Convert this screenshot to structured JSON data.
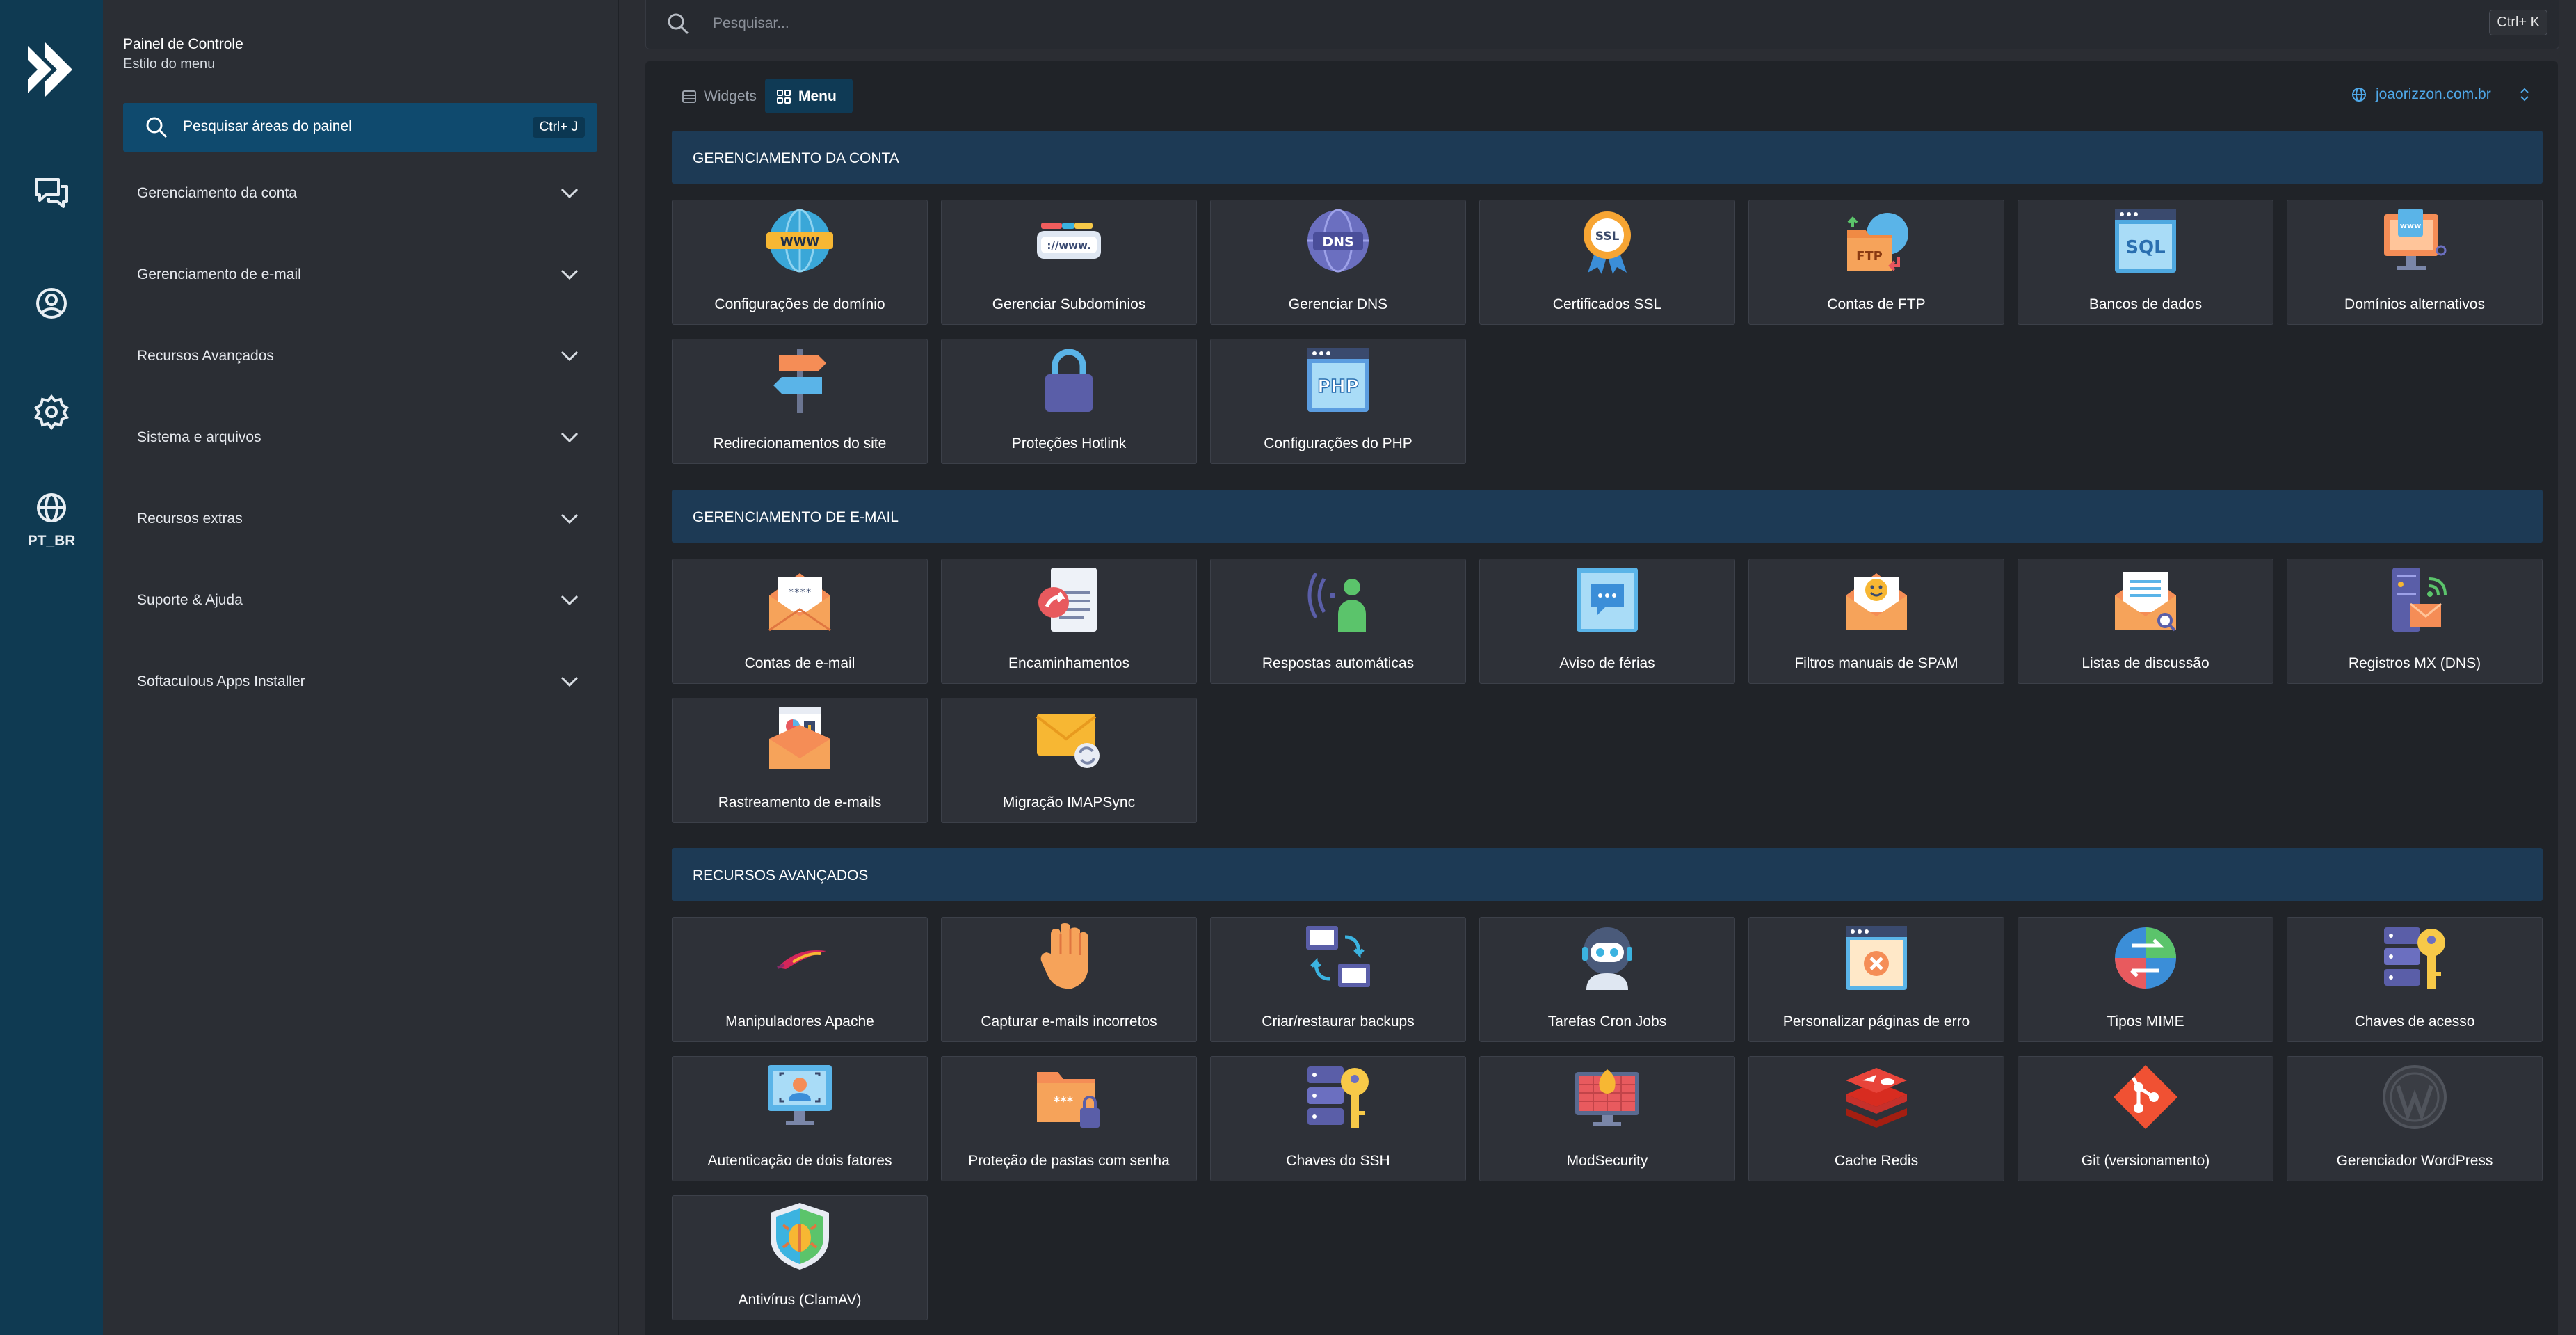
{
  "rail": {
    "logo_icon": "cwp-arrow-logo",
    "icons": [
      "chat-icon",
      "user-circle-icon",
      "gear-icon",
      "globe-icon"
    ],
    "language": "PT_BR"
  },
  "sidebar": {
    "title": "Painel de Controle",
    "subtitle": "Estilo do menu",
    "search_placeholder": "Pesquisar áreas do painel",
    "search_shortcut": "Ctrl+ J",
    "items": [
      {
        "label": "Gerenciamento da conta"
      },
      {
        "label": "Gerenciamento de e-mail"
      },
      {
        "label": "Recursos Avançados"
      },
      {
        "label": "Sistema e arquivos"
      },
      {
        "label": "Recursos extras"
      },
      {
        "label": "Suporte & Ajuda"
      },
      {
        "label": "Softaculous Apps Installer"
      }
    ]
  },
  "topbar": {
    "search_placeholder": "Pesquisar...",
    "shortcut": "Ctrl+ K"
  },
  "main": {
    "tabs": [
      {
        "label": "Widgets",
        "active": false
      },
      {
        "label": "Menu",
        "active": true
      }
    ],
    "domain": "joaorizzon.com.br",
    "sections": [
      {
        "title": "GERENCIAMENTO DA CONTA",
        "tiles": [
          {
            "label": "Configurações de domínio",
            "icon": "www-globe-icon"
          },
          {
            "label": "Gerenciar Subdomínios",
            "icon": "subdomain-bar-icon"
          },
          {
            "label": "Gerenciar DNS",
            "icon": "dns-globe-icon"
          },
          {
            "label": "Certificados SSL",
            "icon": "ssl-badge-icon"
          },
          {
            "label": "Contas de FTP",
            "icon": "ftp-folder-icon"
          },
          {
            "label": "Bancos de dados",
            "icon": "sql-window-icon"
          },
          {
            "label": "Domínios alternativos",
            "icon": "www-monitor-icon"
          },
          {
            "label": "Redirecionamentos do site",
            "icon": "signpost-icon"
          },
          {
            "label": "Proteções Hotlink",
            "icon": "padlock-icon"
          },
          {
            "label": "Configurações do PHP",
            "icon": "php-window-icon"
          }
        ]
      },
      {
        "title": "GERENCIAMENTO DE E-MAIL",
        "tiles": [
          {
            "label": "Contas de e-mail",
            "icon": "mail-envelope-icon"
          },
          {
            "label": "Encaminhamentos",
            "icon": "forward-document-icon"
          },
          {
            "label": "Respostas automáticas",
            "icon": "auto-reply-person-icon"
          },
          {
            "label": "Aviso de férias",
            "icon": "vacation-chat-icon"
          },
          {
            "label": "Filtros manuais de SPAM",
            "icon": "spam-envelope-icon"
          },
          {
            "label": "Listas de discussão",
            "icon": "mailing-list-icon"
          },
          {
            "label": "Registros MX (DNS)",
            "icon": "mx-server-icon"
          },
          {
            "label": "Rastreamento de e-mails",
            "icon": "email-tracking-icon"
          },
          {
            "label": "Migração IMAPSync",
            "icon": "imap-sync-icon"
          }
        ]
      },
      {
        "title": "RECURSOS AVANÇADOS",
        "tiles": [
          {
            "label": "Manipuladores Apache",
            "icon": "apache-feather-icon"
          },
          {
            "label": "Capturar e-mails incorretos",
            "icon": "catch-hand-icon"
          },
          {
            "label": "Criar/restaurar backups",
            "icon": "backup-monitors-icon"
          },
          {
            "label": "Tarefas Cron Jobs",
            "icon": "cron-robot-icon"
          },
          {
            "label": "Personalizar páginas de erro",
            "icon": "error-page-icon"
          },
          {
            "label": "Tipos MIME",
            "icon": "mime-arrows-icon"
          },
          {
            "label": "Chaves de acesso",
            "icon": "access-key-server-icon"
          },
          {
            "label": "Autenticação de dois fatores",
            "icon": "two-factor-monitor-icon"
          },
          {
            "label": "Proteção de pastas com senha",
            "icon": "locked-folder-icon"
          },
          {
            "label": "Chaves do SSH",
            "icon": "ssh-key-server-icon"
          },
          {
            "label": "ModSecurity",
            "icon": "modsecurity-monitor-icon"
          },
          {
            "label": "Cache Redis",
            "icon": "redis-icon"
          },
          {
            "label": "Git (versionamento)",
            "icon": "git-icon"
          },
          {
            "label": "Gerenciador WordPress",
            "icon": "wordpress-icon"
          },
          {
            "label": "Antivírus (ClamAV)",
            "icon": "antivirus-shield-icon"
          }
        ]
      }
    ]
  }
}
